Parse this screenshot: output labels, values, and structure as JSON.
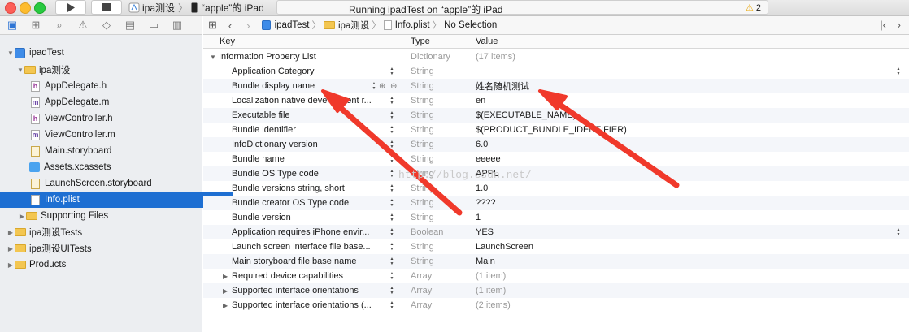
{
  "toolbar": {
    "scheme_target": "ipa测设",
    "scheme_device": "“apple”的 iPad",
    "status": "Running ipadTest on “apple”的 iPad",
    "warning_count": "2"
  },
  "navigator": {
    "items": [
      {
        "label": "ipadTest",
        "kind": "project"
      },
      {
        "label": "ipa测设",
        "kind": "folder"
      },
      {
        "label": "AppDelegate.h",
        "kind": "h"
      },
      {
        "label": "AppDelegate.m",
        "kind": "m"
      },
      {
        "label": "ViewController.h",
        "kind": "h"
      },
      {
        "label": "ViewController.m",
        "kind": "m"
      },
      {
        "label": "Main.storyboard",
        "kind": "storyboard"
      },
      {
        "label": "Assets.xcassets",
        "kind": "assets"
      },
      {
        "label": "LaunchScreen.storyboard",
        "kind": "storyboard"
      },
      {
        "label": "Info.plist",
        "kind": "plist"
      },
      {
        "label": "Supporting Files",
        "kind": "folder"
      },
      {
        "label": "ipa测设Tests",
        "kind": "folder"
      },
      {
        "label": "ipa测设UITests",
        "kind": "folder"
      },
      {
        "label": "Products",
        "kind": "folder"
      }
    ]
  },
  "jumpbar": {
    "project": "ipadTest",
    "group": "ipa测设",
    "file": "Info.plist",
    "selection": "No Selection"
  },
  "plist": {
    "headers": {
      "key": "Key",
      "type": "Type",
      "value": "Value"
    },
    "root": {
      "key": "Information Property List",
      "type": "Dictionary",
      "value": "(17 items)"
    },
    "rows": [
      {
        "key": "Application Category",
        "type": "String",
        "value": ""
      },
      {
        "key": "Bundle display name",
        "type": "String",
        "value": "姓名随机测试"
      },
      {
        "key": "Localization native development r...",
        "type": "String",
        "value": "en"
      },
      {
        "key": "Executable file",
        "type": "String",
        "value": "$(EXECUTABLE_NAME)"
      },
      {
        "key": "Bundle identifier",
        "type": "String",
        "value": "$(PRODUCT_BUNDLE_IDENTIFIER)"
      },
      {
        "key": "InfoDictionary version",
        "type": "String",
        "value": "6.0"
      },
      {
        "key": "Bundle name",
        "type": "String",
        "value": "eeeee"
      },
      {
        "key": "Bundle OS Type code",
        "type": "String",
        "value": "APPL"
      },
      {
        "key": "Bundle versions string, short",
        "type": "String",
        "value": "1.0"
      },
      {
        "key": "Bundle creator OS Type code",
        "type": "String",
        "value": "????"
      },
      {
        "key": "Bundle version",
        "type": "String",
        "value": "1"
      },
      {
        "key": "Application requires iPhone envir...",
        "type": "Boolean",
        "value": "YES"
      },
      {
        "key": "Launch screen interface file base...",
        "type": "String",
        "value": "LaunchScreen"
      },
      {
        "key": "Main storyboard file base name",
        "type": "String",
        "value": "Main"
      },
      {
        "key": "Required device capabilities",
        "type": "Array",
        "value": "(1 item)"
      },
      {
        "key": "Supported interface orientations",
        "type": "Array",
        "value": "(1 item)"
      },
      {
        "key": "Supported interface orientations (...",
        "type": "Array",
        "value": "(2 items)"
      }
    ]
  },
  "watermark": "http://blog.csdn.net/"
}
